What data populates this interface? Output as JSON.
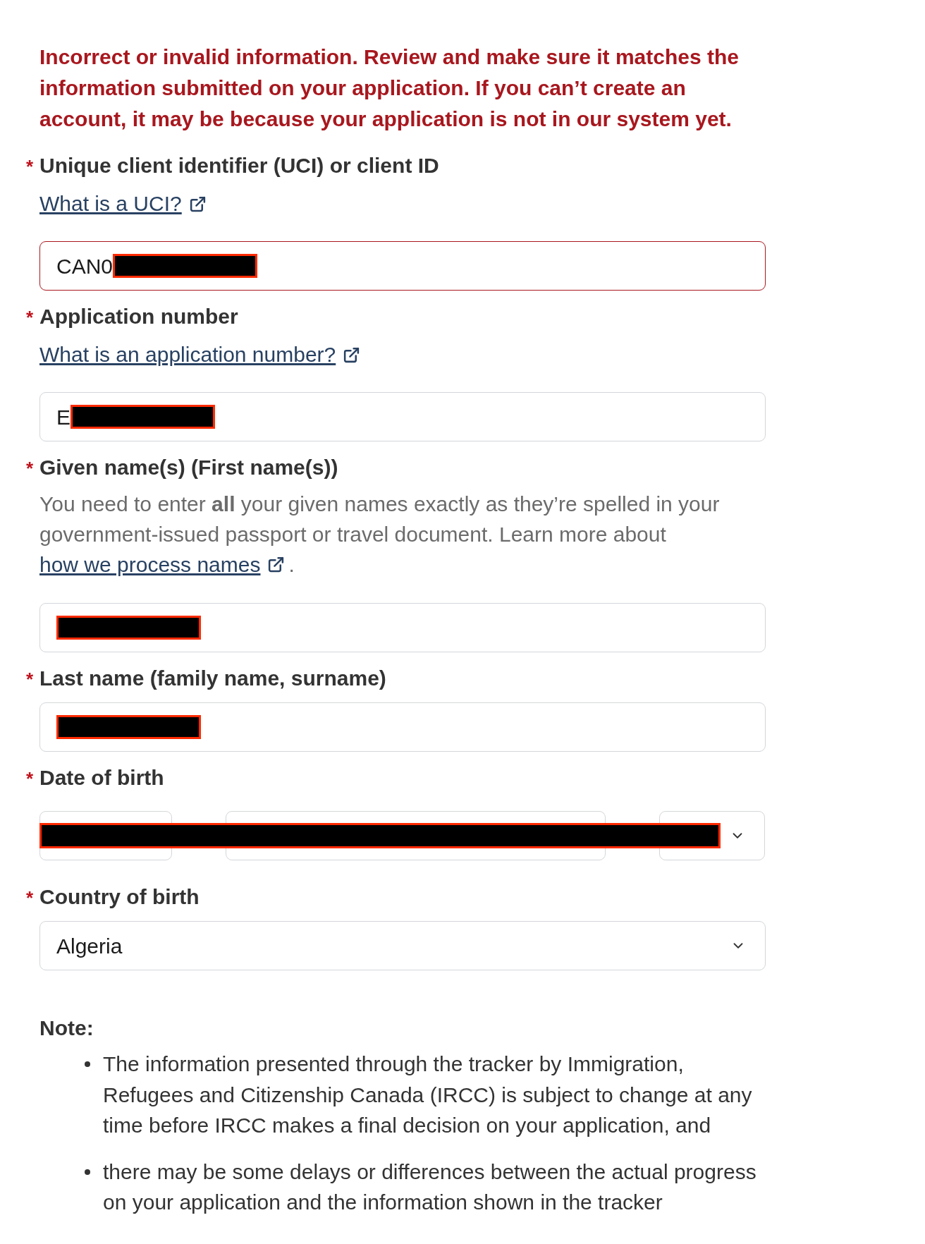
{
  "error_message": "Incorrect or invalid information. Review and make sure it matches the information submitted on your application. If you can’t create an account, it may be because your application is not in our system yet.",
  "fields": [
    {
      "kind": "text",
      "required_marker": "*",
      "label": "Unique client identifier (UCI) or client ID",
      "help_link": "What is a UCI?",
      "input": {
        "value": "CAN0",
        "invalid": true,
        "redacted": true
      }
    },
    {
      "kind": "text",
      "required_marker": "*",
      "label": "Application number",
      "help_link": "What is an application number?",
      "input": {
        "value": "E",
        "invalid": false,
        "redacted": true
      }
    },
    {
      "kind": "text",
      "required_marker": "*",
      "label": "Given name(s) (First name(s))",
      "help": {
        "text": "You need to enter **all** your given names exactly as they’re spelled in your government-issued passport or travel document. Learn more about",
        "link": "how we process names",
        "after": "."
      },
      "input": {
        "invalid": false,
        "redacted": true
      }
    },
    {
      "kind": "text",
      "required_marker": "*",
      "label": "Last name (family name, surname)",
      "input": {
        "invalid": false,
        "redacted": true
      }
    },
    {
      "kind": "date",
      "required_marker": "*",
      "label": "Date of birth",
      "parts": [
        {
          "kind": "box"
        },
        {
          "kind": "box"
        },
        {
          "kind": "dropdown"
        }
      ],
      "invalid": false,
      "redacted": true
    },
    {
      "kind": "select",
      "required_marker": "*",
      "label": "Country of birth",
      "input": {
        "value": "Algeria",
        "invalid": false
      }
    }
  ],
  "note": {
    "title": "Note:",
    "items": [
      "The information presented through the tracker by Immigration, Refugees and Citizenship Canada (IRCC) is subject to change at any time before IRCC makes a final decision on your application, and",
      "there may be some delays or differences between the actual progress on your application and the information shown in the tracker"
    ]
  }
}
